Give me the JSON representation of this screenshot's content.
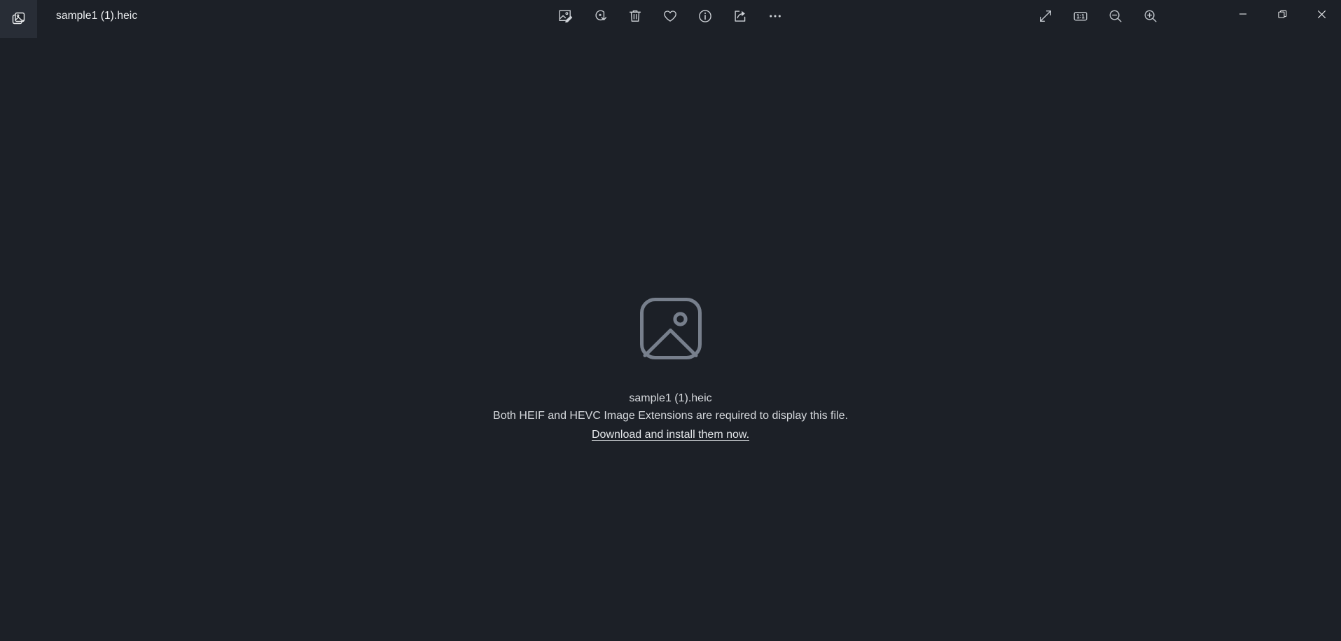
{
  "window": {
    "title": "sample1 (1).heic",
    "app_icon": "photos-stack-icon",
    "background_color": "#1c2027",
    "tab_background_color": "#282d36"
  },
  "titlebar": {
    "tools": [
      {
        "name": "edit-image-button",
        "icon": "edit-image-icon",
        "label": "Edit image"
      },
      {
        "name": "rotate-button",
        "icon": "rotate-icon",
        "label": "Rotate"
      },
      {
        "name": "delete-button",
        "icon": "trash-icon",
        "label": "Delete"
      },
      {
        "name": "favorite-button",
        "icon": "heart-icon",
        "label": "Add to favorites"
      },
      {
        "name": "info-button",
        "icon": "info-icon",
        "label": "File info"
      },
      {
        "name": "share-button",
        "icon": "share-icon",
        "label": "Share"
      },
      {
        "name": "more-options-button",
        "icon": "ellipsis-icon",
        "label": "See more"
      }
    ],
    "view_tools": [
      {
        "name": "fullscreen-button",
        "icon": "fullscreen-arrows-icon",
        "label": "Enter fullscreen"
      },
      {
        "name": "actual-size-button",
        "icon": "one-to-one-icon",
        "label": "1:1"
      },
      {
        "name": "zoom-out-button",
        "icon": "zoom-out-icon",
        "label": "Zoom out"
      },
      {
        "name": "zoom-in-button",
        "icon": "zoom-in-icon",
        "label": "Zoom in"
      }
    ],
    "window_controls": [
      {
        "name": "minimize-button",
        "icon": "minimize-icon",
        "label": "Minimize"
      },
      {
        "name": "restore-button",
        "icon": "restore-icon",
        "label": "Restore"
      },
      {
        "name": "close-button",
        "icon": "close-icon",
        "label": "Close"
      }
    ]
  },
  "main": {
    "placeholder_icon": "image-placeholder-icon",
    "file_name": "sample1 (1).heic",
    "message": "Both HEIF and HEVC Image Extensions are required to display this file.",
    "link_text": "Download and install them now.",
    "text_color": "#d6d9dd",
    "icon_color": "#777f8c"
  }
}
